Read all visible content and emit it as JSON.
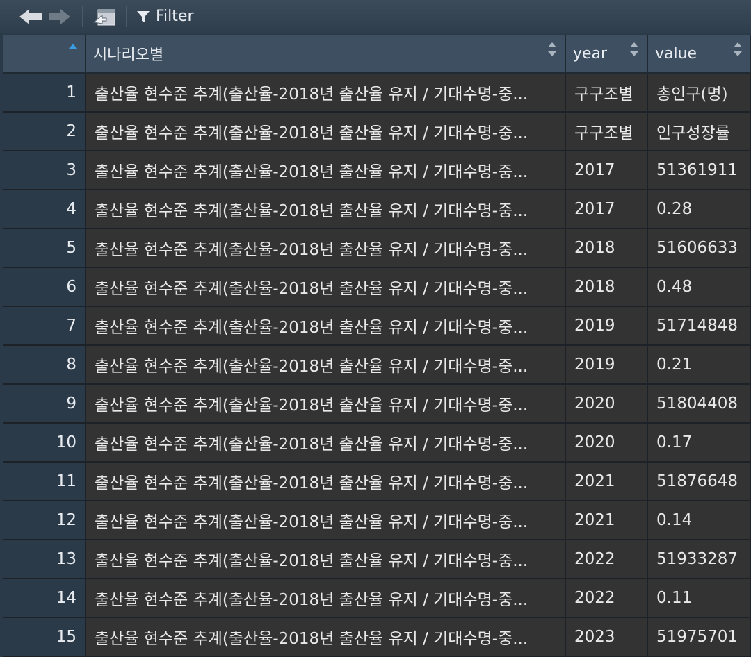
{
  "toolbar": {
    "back_icon": "arrow-left-icon",
    "forward_icon": "arrow-right-icon",
    "popout_icon": "popout-window-icon",
    "filter_icon": "funnel-icon",
    "filter_label": "Filter"
  },
  "columns": [
    "",
    "시나리오별",
    "year",
    "value"
  ],
  "rows": [
    {
      "idx": "1",
      "scenario": "출산율 현수준 추계(출산율-2018년 출산율 유지 / 기대수명-중...",
      "year": "구구조별",
      "value": "총인구(명)"
    },
    {
      "idx": "2",
      "scenario": "출산율 현수준 추계(출산율-2018년 출산율 유지 / 기대수명-중...",
      "year": "구구조별",
      "value": "인구성장률"
    },
    {
      "idx": "3",
      "scenario": "출산율 현수준 추계(출산율-2018년 출산율 유지 / 기대수명-중...",
      "year": "2017",
      "value": "51361911"
    },
    {
      "idx": "4",
      "scenario": "출산율 현수준 추계(출산율-2018년 출산율 유지 / 기대수명-중...",
      "year": "2017",
      "value": "0.28"
    },
    {
      "idx": "5",
      "scenario": "출산율 현수준 추계(출산율-2018년 출산율 유지 / 기대수명-중...",
      "year": "2018",
      "value": "51606633"
    },
    {
      "idx": "6",
      "scenario": "출산율 현수준 추계(출산율-2018년 출산율 유지 / 기대수명-중...",
      "year": "2018",
      "value": "0.48"
    },
    {
      "idx": "7",
      "scenario": "출산율 현수준 추계(출산율-2018년 출산율 유지 / 기대수명-중...",
      "year": "2019",
      "value": "51714848"
    },
    {
      "idx": "8",
      "scenario": "출산율 현수준 추계(출산율-2018년 출산율 유지 / 기대수명-중...",
      "year": "2019",
      "value": "0.21"
    },
    {
      "idx": "9",
      "scenario": "출산율 현수준 추계(출산율-2018년 출산율 유지 / 기대수명-중...",
      "year": "2020",
      "value": "51804408"
    },
    {
      "idx": "10",
      "scenario": "출산율 현수준 추계(출산율-2018년 출산율 유지 / 기대수명-중...",
      "year": "2020",
      "value": "0.17"
    },
    {
      "idx": "11",
      "scenario": "출산율 현수준 추계(출산율-2018년 출산율 유지 / 기대수명-중...",
      "year": "2021",
      "value": "51876648"
    },
    {
      "idx": "12",
      "scenario": "출산율 현수준 추계(출산율-2018년 출산율 유지 / 기대수명-중...",
      "year": "2021",
      "value": "0.14"
    },
    {
      "idx": "13",
      "scenario": "출산율 현수준 추계(출산율-2018년 출산율 유지 / 기대수명-중...",
      "year": "2022",
      "value": "51933287"
    },
    {
      "idx": "14",
      "scenario": "출산율 현수준 추계(출산율-2018년 출산율 유지 / 기대수명-중...",
      "year": "2022",
      "value": "0.11"
    },
    {
      "idx": "15",
      "scenario": "출산율 현수준 추계(출산율-2018년 출산율 유지 / 기대수명-중...",
      "year": "2023",
      "value": "51975701"
    }
  ]
}
